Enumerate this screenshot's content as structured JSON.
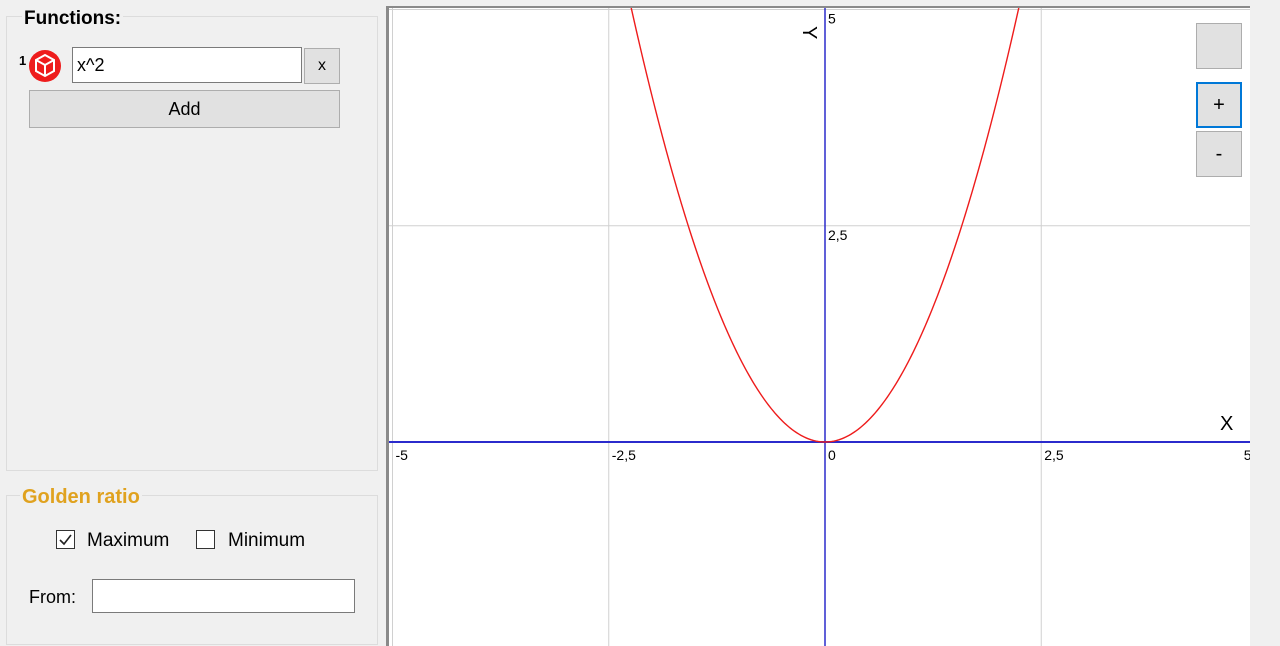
{
  "functions": {
    "title": "Functions:",
    "items": [
      {
        "index": "1",
        "expression": "x^2",
        "remove_label": "x",
        "color": "#ee1c1c",
        "icon": "cube-icon"
      }
    ],
    "add_label": "Add"
  },
  "golden_ratio": {
    "title": "Golden ratio",
    "maximum": {
      "label": "Maximum",
      "checked": true
    },
    "minimum": {
      "label": "Minimum",
      "checked": false
    },
    "from_label": "From:",
    "from_value": ""
  },
  "zoom": {
    "reset_label": "",
    "in_label": "+",
    "out_label": "-"
  },
  "chart_data": {
    "type": "line",
    "series": [
      {
        "expression": "x^2",
        "color": "#ee1c1c"
      }
    ],
    "xlim": [
      -5,
      5
    ],
    "ylim": [
      -5,
      5
    ],
    "x_ticks": [
      "-5",
      "-2,5",
      "0",
      "2,5",
      "5"
    ],
    "y_ticks": [
      "2,5",
      "5"
    ],
    "xlabel": "X",
    "ylabel": "Y",
    "grid": true,
    "axis_color": "#2b2bcc",
    "grid_color": "#d0d0d0"
  }
}
